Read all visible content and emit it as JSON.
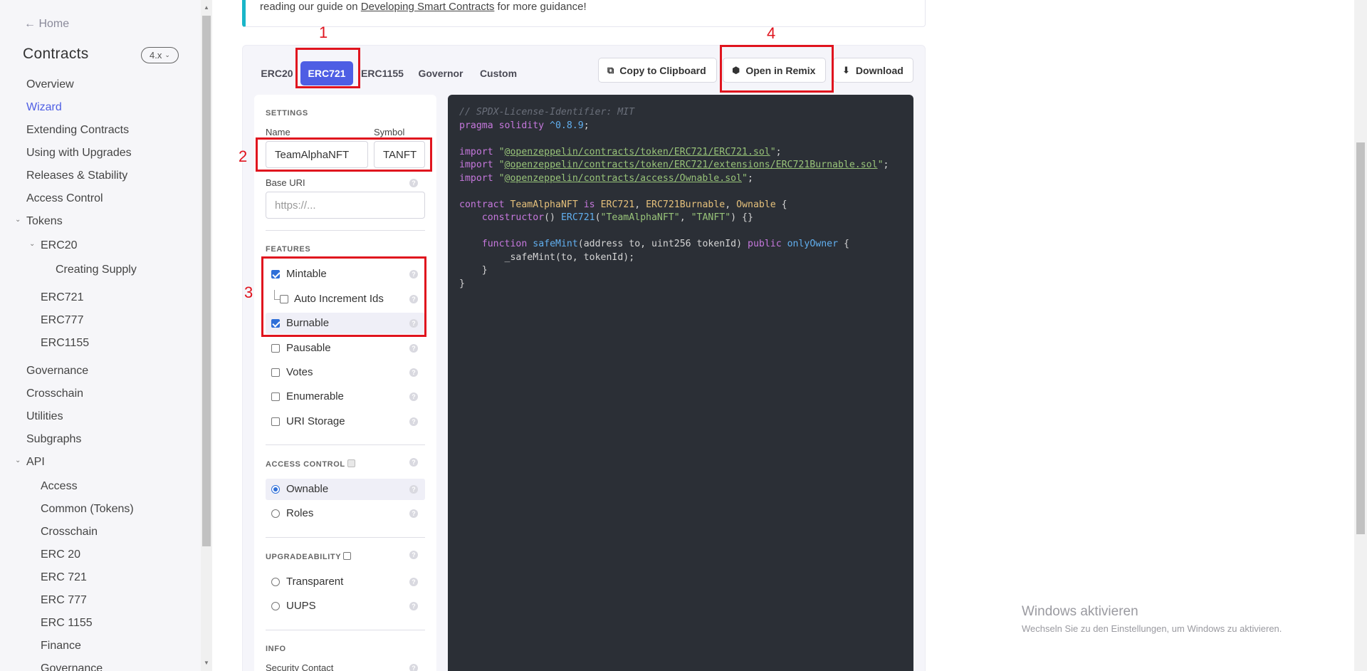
{
  "sidebar": {
    "home": "← Home",
    "title": "Contracts",
    "version": "4.x",
    "items": [
      {
        "label": "Overview"
      },
      {
        "label": "Wizard"
      },
      {
        "label": "Extending Contracts"
      },
      {
        "label": "Using with Upgrades"
      },
      {
        "label": "Releases & Stability"
      },
      {
        "label": "Access Control"
      },
      {
        "label": "Tokens"
      },
      {
        "label": "ERC20"
      },
      {
        "label": "Creating Supply"
      },
      {
        "label": "ERC721"
      },
      {
        "label": "ERC777"
      },
      {
        "label": "ERC1155"
      },
      {
        "label": "Governance"
      },
      {
        "label": "Crosschain"
      },
      {
        "label": "Utilities"
      },
      {
        "label": "Subgraphs"
      },
      {
        "label": "API"
      },
      {
        "label": "Access"
      },
      {
        "label": "Common (Tokens)"
      },
      {
        "label": "Crosschain"
      },
      {
        "label": "ERC 20"
      },
      {
        "label": "ERC 721"
      },
      {
        "label": "ERC 777"
      },
      {
        "label": "ERC 1155"
      },
      {
        "label": "Finance"
      },
      {
        "label": "Governance"
      }
    ]
  },
  "notice": {
    "prefix": "reading our guide on ",
    "link": "Developing Smart Contracts",
    "suffix": " for more guidance!"
  },
  "tabs": [
    {
      "label": "ERC20"
    },
    {
      "label": "ERC721"
    },
    {
      "label": "ERC1155"
    },
    {
      "label": "Governor"
    },
    {
      "label": "Custom"
    }
  ],
  "active_tab": "ERC721",
  "toolbar": {
    "copy": "Copy to Clipboard",
    "remix": "Open in Remix",
    "download": "Download"
  },
  "settings": {
    "heading": "Settings",
    "name_label": "Name",
    "name_value": "TeamAlphaNFT",
    "symbol_label": "Symbol",
    "symbol_value": "TANFT",
    "base_uri_label": "Base URI",
    "base_uri_placeholder": "https://..."
  },
  "features": {
    "heading": "Features",
    "items": [
      {
        "label": "Mintable",
        "checked": true
      },
      {
        "label": "Auto Increment Ids",
        "checked": false
      },
      {
        "label": "Burnable",
        "checked": true
      },
      {
        "label": "Pausable",
        "checked": false
      },
      {
        "label": "Votes",
        "checked": false
      },
      {
        "label": "Enumerable",
        "checked": false
      },
      {
        "label": "URI Storage",
        "checked": false
      }
    ]
  },
  "access_control": {
    "heading": "Access Control",
    "options": [
      {
        "label": "Ownable",
        "selected": true
      },
      {
        "label": "Roles",
        "selected": false
      }
    ]
  },
  "upgradeability": {
    "heading": "Upgradeability",
    "options": [
      {
        "label": "Transparent",
        "selected": false
      },
      {
        "label": "UUPS",
        "selected": false
      }
    ]
  },
  "info": {
    "heading": "Info",
    "security_contact": "Security Contact"
  },
  "code": {
    "license": "// SPDX-License-Identifier: MIT",
    "pragma_kw": "pragma solidity",
    "pragma_ver": "^0.8.9",
    "imports": [
      "@openzeppelin/contracts/token/ERC721/ERC721.sol",
      "@openzeppelin/contracts/token/ERC721/extensions/ERC721Burnable.sol",
      "@openzeppelin/contracts/access/Ownable.sol"
    ],
    "contract_name": "TeamAlphaNFT",
    "bases": [
      "ERC721",
      "ERC721Burnable",
      "Ownable"
    ],
    "ctor_args": [
      "\"TeamAlphaNFT\"",
      "\"TANFT\""
    ],
    "fn_name": "safeMint",
    "fn_params": "address to, uint256 tokenId",
    "fn_modifier": "onlyOwner",
    "fn_body": "_safeMint(to, tokenId);"
  },
  "watermark": {
    "line1": "Windows aktivieren",
    "line2": "Wechseln Sie zu den Einstellungen, um Windows zu aktivieren."
  },
  "annotations": {
    "n1": "1",
    "n2": "2",
    "n3": "3",
    "n4": "4",
    "color": "#e0141e"
  },
  "colors": {
    "accent": "#4e5ee4",
    "notice_bar": "#19b5c8",
    "checkbox": "#2f6fd8",
    "code_bg": "#2b2f36"
  }
}
